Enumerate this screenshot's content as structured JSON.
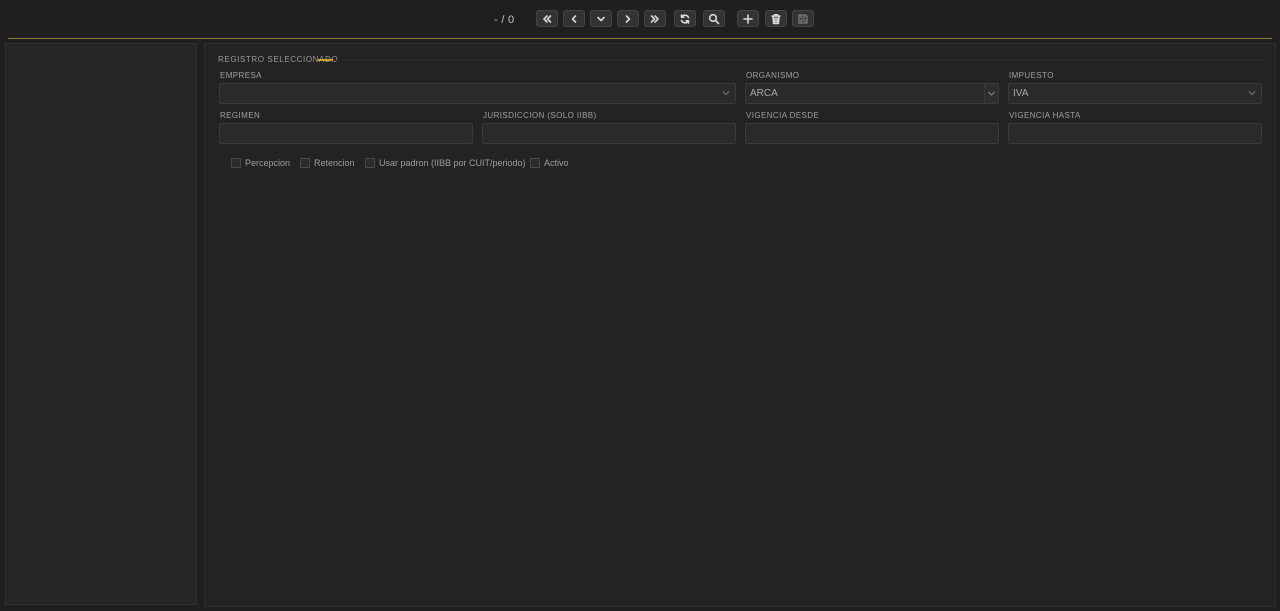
{
  "toolbar": {
    "record_counter": "- / 0",
    "buttons": [
      {
        "name": "first-record",
        "icon": "double-chevron-left-icon"
      },
      {
        "name": "prev-record",
        "icon": "chevron-left-icon"
      },
      {
        "name": "dropdown",
        "icon": "chevron-down-icon"
      },
      {
        "name": "next-record",
        "icon": "chevron-right-icon"
      },
      {
        "name": "last-record",
        "icon": "double-chevron-right-icon"
      },
      {
        "name": "refresh",
        "icon": "refresh-icon"
      },
      {
        "name": "search",
        "icon": "search-icon"
      },
      {
        "name": "add",
        "icon": "plus-icon"
      },
      {
        "name": "delete",
        "icon": "trash-icon"
      },
      {
        "name": "save",
        "icon": "save-icon"
      }
    ]
  },
  "section": {
    "title": "REGISTRO SELECCIONADO",
    "accent_color": "#c9a227"
  },
  "form": {
    "empresa": {
      "label": "EMPRESA",
      "value": ""
    },
    "organismo": {
      "label": "ORGANISMO",
      "value": "ARCA"
    },
    "impuesto": {
      "label": "IMPUESTO",
      "value": "IVA"
    },
    "regimen": {
      "label": "REGIMEN",
      "value": ""
    },
    "jurisdiccion": {
      "label": "JURISDICCION (SOLO IIBB)",
      "value": ""
    },
    "vigencia_desde": {
      "label": "VIGENCIA DESDE",
      "value": ""
    },
    "vigencia_hasta": {
      "label": "VIGENCIA HASTA",
      "value": ""
    }
  },
  "checks": {
    "percepcion": {
      "label": "Percepcion",
      "checked": false
    },
    "retencion": {
      "label": "Retencion",
      "checked": false
    },
    "usar_padron": {
      "label": "Usar padron (IIBB por CUIT/periodo)",
      "checked": false
    },
    "activo": {
      "label": "Activo",
      "checked": false
    }
  }
}
